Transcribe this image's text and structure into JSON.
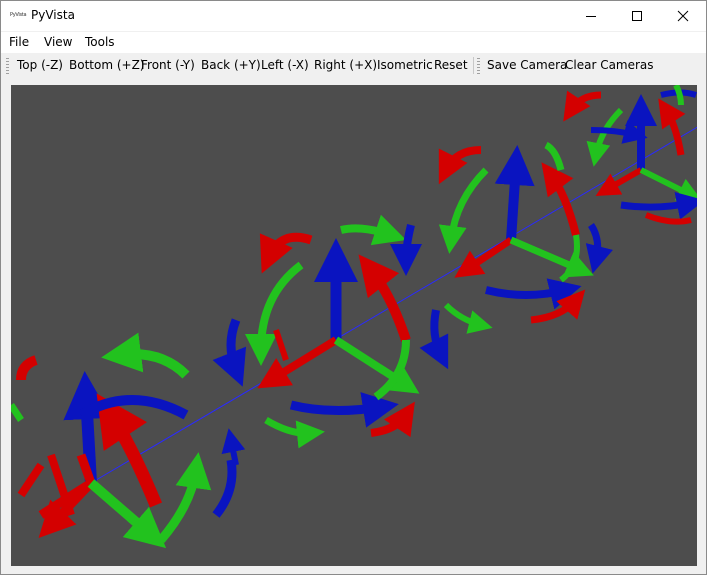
{
  "window": {
    "title": "PyVista",
    "icon_label": "PyVista",
    "controls": {
      "minimize_icon": "minimize-icon",
      "maximize_icon": "maximize-icon",
      "close_icon": "close-icon"
    }
  },
  "menu": {
    "items": [
      {
        "label": "File"
      },
      {
        "label": "View"
      },
      {
        "label": "Tools"
      }
    ]
  },
  "toolbar": {
    "view_buttons": [
      {
        "label": "Top (-Z)"
      },
      {
        "label": "Bottom (+Z)"
      },
      {
        "label": "Front (-Y)"
      },
      {
        "label": "Back (+Y)"
      },
      {
        "label": "Left (-X)"
      },
      {
        "label": "Right (+X)"
      },
      {
        "label": "Isometric"
      },
      {
        "label": "Reset"
      }
    ],
    "camera_buttons": [
      {
        "label": "Save Camera"
      },
      {
        "label": "Clear Cameras"
      }
    ]
  },
  "viewport": {
    "background": "#4d4d4d",
    "scene": "repeated 3D axes glyphs with rotation arrows",
    "colors": {
      "x_axis": "#e60000",
      "y_axis": "#00c000",
      "z_axis": "#0000c8",
      "line": "#2020ff"
    }
  }
}
